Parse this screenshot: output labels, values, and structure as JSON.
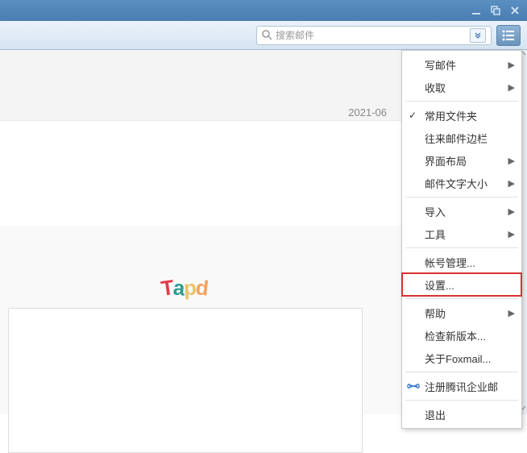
{
  "titlebar": {
    "minimize": "minimize",
    "maximize": "maximize",
    "close": "close"
  },
  "toolbar": {
    "search_placeholder": "搜索邮件"
  },
  "content": {
    "date_label": "2021-06"
  },
  "menu": {
    "compose": "写邮件",
    "receive": "收取",
    "common_folders": "常用文件夹",
    "contacts_sidebar": "往来邮件边栏",
    "layout": "界面布局",
    "font_size": "邮件文字大小",
    "import": "导入",
    "tools": "工具",
    "account_mgmt": "帐号管理...",
    "settings": "设置...",
    "help": "帮助",
    "check_update": "检查新版本...",
    "about": "关于Foxmail...",
    "register_mail": "注册腾讯企业邮",
    "exit": "退出"
  }
}
